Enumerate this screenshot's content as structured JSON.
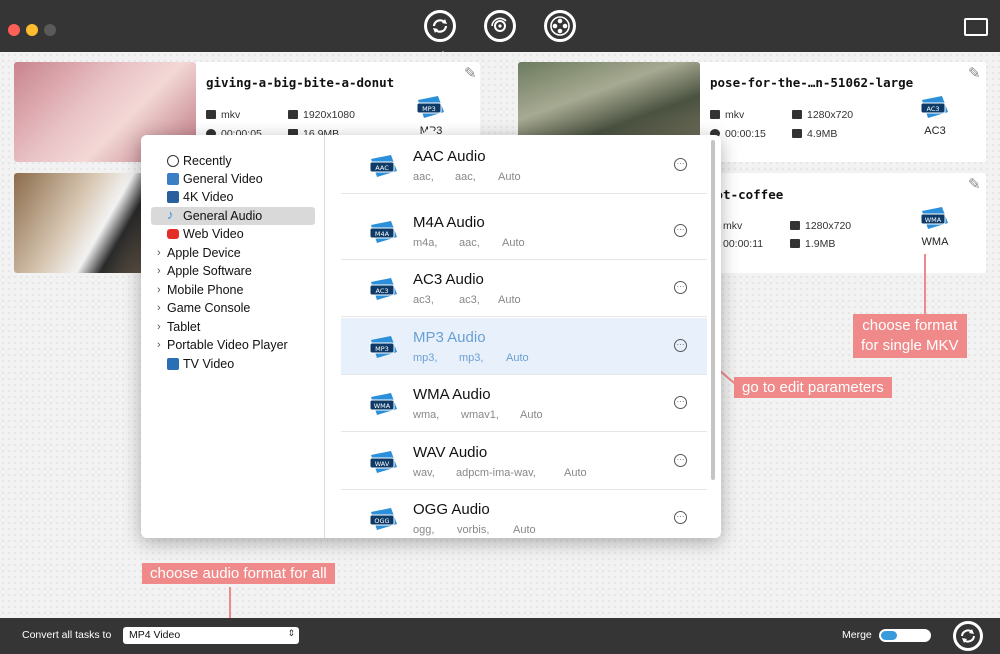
{
  "app": {
    "top_icons": [
      "convert-icon",
      "audio-convert-icon",
      "video-reel-icon"
    ],
    "right_icon": "film-export-icon"
  },
  "colors": {
    "titlebar": "#353535",
    "accent_blue": "#3a9bdc",
    "callout": "#f08a8a",
    "selected_text": "#6a9fd4"
  },
  "cards": [
    {
      "title": "giving-a-big-bite-a-donut",
      "container": "mkv",
      "resolution": "1920x1080",
      "duration": "00:00:05",
      "size": "16.9MB",
      "format_label": "MP3",
      "format_icon": "MP3"
    },
    {
      "title": "pose-for-the-…n-51062-large",
      "container": "mkv",
      "resolution": "1280x720",
      "duration": "00:00:15",
      "size": "4.9MB",
      "format_label": "AC3",
      "format_icon": "AC3"
    },
    {
      "title": "…ot-coffee",
      "container": "mkv",
      "resolution": "1280x720",
      "duration": "00:00:11",
      "size": "1.9MB",
      "format_label": "WMA",
      "format_icon": "WMA"
    }
  ],
  "categories": [
    {
      "label": "Recently",
      "icon": "history-icon",
      "expandable": false
    },
    {
      "label": "General Video",
      "icon": "film-icon",
      "expandable": false
    },
    {
      "label": "4K Video",
      "icon": "4k-icon",
      "expandable": false
    },
    {
      "label": "General Audio",
      "icon": "music-note-icon",
      "expandable": false,
      "selected": true
    },
    {
      "label": "Web Video",
      "icon": "youtube-icon",
      "expandable": false
    },
    {
      "label": "Apple Device",
      "expandable": true
    },
    {
      "label": "Apple Software",
      "expandable": true
    },
    {
      "label": "Mobile Phone",
      "expandable": true
    },
    {
      "label": "Game Console",
      "expandable": true
    },
    {
      "label": "Tablet",
      "expandable": true
    },
    {
      "label": "Portable Video Player",
      "expandable": true
    },
    {
      "label": "TV Video",
      "icon": "tv-icon",
      "expandable": false
    }
  ],
  "formats": [
    {
      "name": "AAC Audio",
      "icon": "AAC",
      "ext": "aac,",
      "codec": "aac,",
      "quality": "Auto"
    },
    {
      "name": "M4A Audio",
      "icon": "M4A",
      "ext": "m4a,",
      "codec": "aac,",
      "quality": "Auto"
    },
    {
      "name": "AC3 Audio",
      "icon": "AC3",
      "ext": "ac3,",
      "codec": "ac3,",
      "quality": "Auto"
    },
    {
      "name": "MP3 Audio",
      "icon": "MP3",
      "ext": "mp3,",
      "codec": "mp3,",
      "quality": "Auto",
      "selected": true
    },
    {
      "name": "WMA Audio",
      "icon": "WMA",
      "ext": "wma,",
      "codec": "wmav1,",
      "quality": "Auto"
    },
    {
      "name": "WAV Audio",
      "icon": "WAV",
      "ext": "wav,",
      "codec": "adpcm-ima-wav,",
      "quality": "Auto"
    },
    {
      "name": "OGG Audio",
      "icon": "OGG",
      "ext": "ogg,",
      "codec": "vorbis,",
      "quality": "Auto"
    }
  ],
  "callouts": {
    "single": "choose format\nfor single MKV",
    "edit": "go to edit parameters",
    "all": "choose audio format for all"
  },
  "bottom": {
    "convert_label": "Convert all tasks to",
    "convert_value": "MP4 Video",
    "merge_label": "Merge",
    "merge_on": true
  }
}
